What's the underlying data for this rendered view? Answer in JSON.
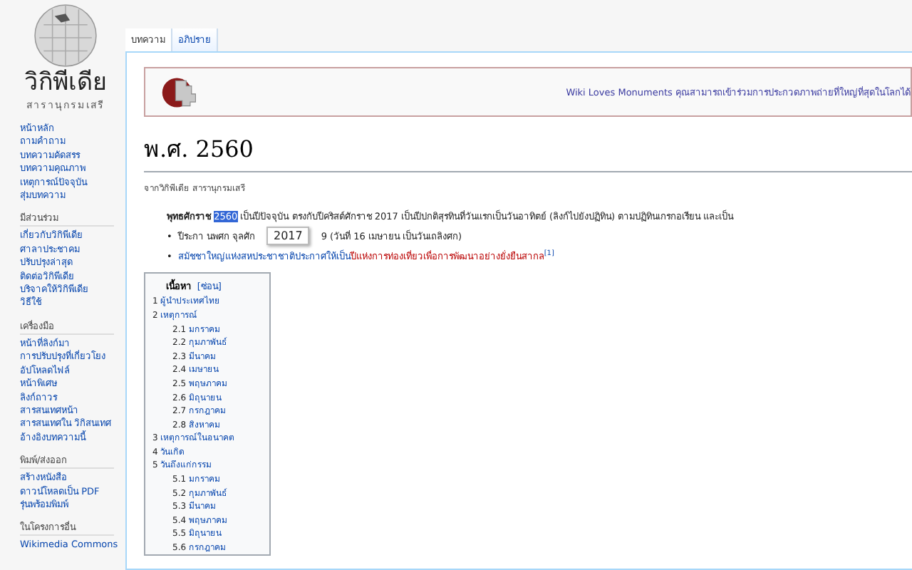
{
  "logo": {
    "name": "วิกิพีเดีย",
    "tagline": "สารานุกรมเสรี"
  },
  "sidebar": {
    "items": [
      {
        "label": "หน้าหลัก"
      },
      {
        "label": "ถามคำถาม"
      },
      {
        "label": "บทความคัดสรร"
      },
      {
        "label": "บทความคุณภาพ"
      },
      {
        "label": "เหตุการณ์ปัจจุบัน"
      },
      {
        "label": "สุ่มบทความ"
      }
    ],
    "sections": [
      {
        "heading": "มีส่วนร่วม",
        "items": [
          "เกี่ยวกับวิกิพีเดีย",
          "ศาลาประชาคม",
          "ปรับปรุงล่าสุด",
          "ติดต่อวิกิพีเดีย",
          "บริจาคให้วิกิพีเดีย",
          "วิธีใช้"
        ]
      },
      {
        "heading": "เครื่องมือ",
        "items": [
          "หน้าที่ลิงก์มา",
          "การปรับปรุงที่เกี่ยวโยง",
          "อัปโหลดไฟล์",
          "หน้าพิเศษ",
          "ลิงก์ถาวร",
          "สารสนเทศหน้า",
          "สารสนเทศใน วิกิสนเทศ",
          "อ้างอิงบทความนี้"
        ]
      },
      {
        "heading": "พิมพ์/ส่งออก",
        "items": [
          "สร้างหนังสือ",
          "ดาวน์โหลดเป็น PDF",
          "รุ่นพร้อมพิมพ์"
        ]
      },
      {
        "heading": "ในโครงการอื่น",
        "items": [
          "Wikimedia Commons"
        ]
      }
    ]
  },
  "tabs": [
    {
      "label": "บทความ",
      "selected": true
    },
    {
      "label": "อภิปราย",
      "selected": false
    }
  ],
  "banner": {
    "text": "Wiki Loves Monuments คุณสามารถเข้าร่วมการประกวดภาพถ่ายที่ใหญ่ที่สุดในโลกได้"
  },
  "title": "พ.ศ. 2560",
  "subtitle": "จากวิกิพีเดีย สารานุกรมเสรี",
  "intro": {
    "lead": "พุทธศักราช",
    "selected_text": "2560",
    "rest": "เป็นปีปัจจุบัน ตรงกับปีคริสต์ศักราช 2017 เป็นปีปกติสุรทินที่วันแรกเป็นวันอาทิตย์ (ลิงก์ไปยังปฏิทิน) ตามปฏิทินเกรกอเรียน และเป็น"
  },
  "tooltip": "2017",
  "bullets": [
    {
      "marker": "•",
      "before": "ปีระกา นพศก จุลศัก",
      "after": "9 (วันที่ 16 เมษายน เป็นวันเถลิงศก)"
    },
    {
      "marker": "•",
      "link": "สมัชชาใหญ่แห่งสหประชาชาติประกาศให้เป็น",
      "red_link": "ปีแห่งการท่องเที่ยวเพื่อการพัฒนาอย่างยั่งยืนสากล",
      "note": "[1]"
    }
  ],
  "toc": {
    "title": "เนื้อหา",
    "toggle": "[ซ่อน]",
    "items": [
      {
        "number": "1",
        "label": "ผู้นำประเทศไทย"
      },
      {
        "number": "2",
        "label": "เหตุการณ์",
        "children": [
          {
            "number": "2.1",
            "label": "มกราคม"
          },
          {
            "number": "2.2",
            "label": "กุมภาพันธ์"
          },
          {
            "number": "2.3",
            "label": "มีนาคม"
          },
          {
            "number": "2.4",
            "label": "เมษายน"
          },
          {
            "number": "2.5",
            "label": "พฤษภาคม"
          },
          {
            "number": "2.6",
            "label": "มิถุนายน"
          },
          {
            "number": "2.7",
            "label": "กรกฎาคม"
          },
          {
            "number": "2.8",
            "label": "สิงหาคม"
          }
        ]
      },
      {
        "number": "3",
        "label": "เหตุการณ์ในอนาคต"
      },
      {
        "number": "4",
        "label": "วันเกิด"
      },
      {
        "number": "5",
        "label": "วันถึงแก่กรรม",
        "children": [
          {
            "number": "5.1",
            "label": "มกราคม"
          },
          {
            "number": "5.2",
            "label": "กุมภาพันธ์"
          },
          {
            "number": "5.3",
            "label": "มีนาคม"
          },
          {
            "number": "5.4",
            "label": "พฤษภาคม"
          },
          {
            "number": "5.5",
            "label": "มิถุนายน"
          },
          {
            "number": "5.6",
            "label": "กรกฎาคม"
          }
        ]
      }
    ]
  }
}
